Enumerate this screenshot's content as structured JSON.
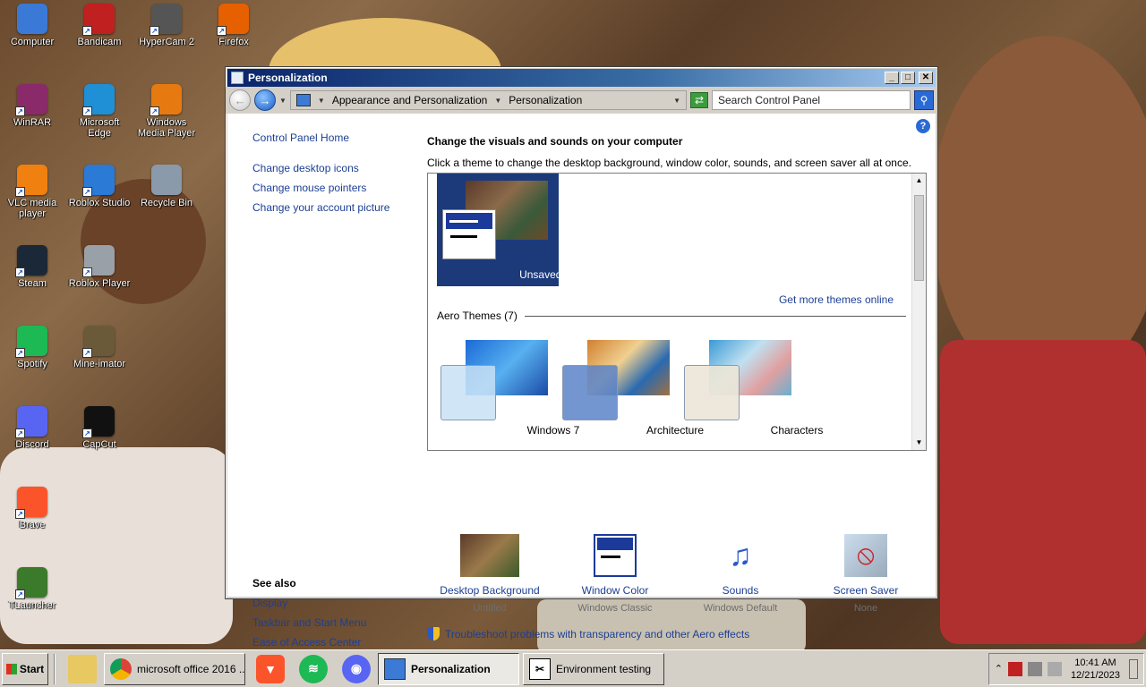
{
  "desktop": {
    "icons": [
      {
        "name": "computer",
        "label": "Computer",
        "color": "#3a7ad6"
      },
      {
        "name": "bandicam",
        "label": "Bandicam",
        "color": "#c02020"
      },
      {
        "name": "hypercam",
        "label": "HyperCam 2",
        "color": "#555555"
      },
      {
        "name": "firefox",
        "label": "Firefox",
        "color": "#e66000"
      },
      {
        "name": "winrar",
        "label": "WinRAR",
        "color": "#8a2a6a"
      },
      {
        "name": "edge",
        "label": "Microsoft Edge",
        "color": "#1f8fd6"
      },
      {
        "name": "wmp",
        "label": "Windows Media Player",
        "color": "#e67a10"
      },
      {
        "name": "vlc",
        "label": "VLC media player",
        "color": "#f08010"
      },
      {
        "name": "roblox-studio",
        "label": "Roblox Studio",
        "color": "#2a7ad6"
      },
      {
        "name": "recycle-bin",
        "label": "Recycle Bin",
        "color": "#8a9aaa"
      },
      {
        "name": "steam",
        "label": "Steam",
        "color": "#1b2838"
      },
      {
        "name": "roblox-player",
        "label": "Roblox Player",
        "color": "#9aa0a8"
      },
      {
        "name": "spotify",
        "label": "Spotify",
        "color": "#1db954"
      },
      {
        "name": "mine-imator",
        "label": "Mine-imator",
        "color": "#6a5a3a"
      },
      {
        "name": "discord",
        "label": "Discord",
        "color": "#5865f2"
      },
      {
        "name": "capcut",
        "label": "CapCut",
        "color": "#111111"
      },
      {
        "name": "brave",
        "label": "Brave",
        "color": "#fb542b"
      },
      {
        "name": "tlauncher",
        "label": "TLauncher",
        "color": "#3a7a2a"
      }
    ]
  },
  "window": {
    "title": "Personalization",
    "address": {
      "crumb1": "Appearance and Personalization",
      "crumb2": "Personalization"
    },
    "search": {
      "placeholder": "Search Control Panel"
    },
    "sidebar": {
      "home": "Control Panel Home",
      "links": [
        "Change desktop icons",
        "Change mouse pointers",
        "Change your account picture"
      ],
      "see_also_header": "See also",
      "see_also": [
        "Display",
        "Taskbar and Start Menu",
        "Ease of Access Center"
      ]
    },
    "main": {
      "heading": "Change the visuals and sounds on your computer",
      "subtitle": "Click a theme to change the desktop background, window color, sounds, and screen saver all at once.",
      "unsaved_theme": "Unsaved Theme",
      "get_more": "Get more themes online",
      "aero_header": "Aero Themes (7)",
      "themes": [
        "Windows 7",
        "Architecture",
        "Characters"
      ]
    },
    "settings": [
      {
        "label": "Desktop Background",
        "value": "Untitled"
      },
      {
        "label": "Window Color",
        "value": "Windows Classic"
      },
      {
        "label": "Sounds",
        "value": "Windows Default"
      },
      {
        "label": "Screen Saver",
        "value": "None"
      }
    ],
    "troubleshoot": "Troubleshoot problems with transparency and other Aero effects"
  },
  "taskbar": {
    "start": "Start",
    "tasks": [
      {
        "label": "microsoft office 2016 ...",
        "active": false
      },
      {
        "label": "Personalization",
        "active": true
      },
      {
        "label": "Environment testing",
        "active": false
      }
    ],
    "time": "10:41 AM",
    "date": "12/21/2023"
  }
}
